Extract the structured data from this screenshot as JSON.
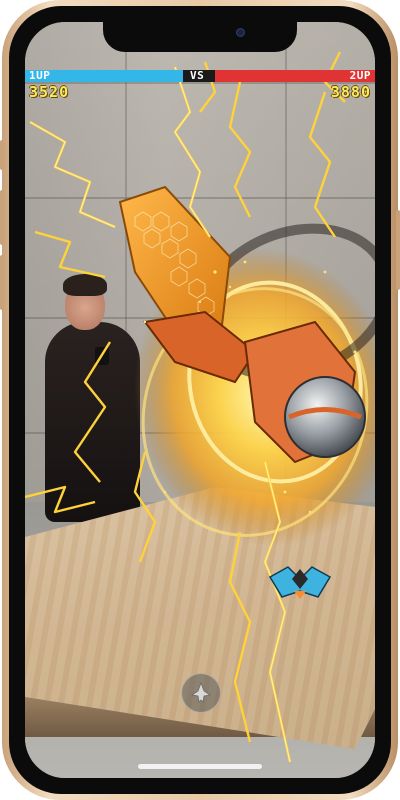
{
  "hud": {
    "player1_label": "1UP",
    "vs_label": "VS",
    "player2_label": "2UP",
    "player1_score": "3520",
    "player2_score": "3880"
  },
  "colors": {
    "player1_bar": "#33b7e8",
    "player2_bar": "#e03434",
    "score_text": "#f7e96a",
    "lightning": "#ffd23a"
  },
  "controls": {
    "fire_button_icon": "fighter-ship-icon"
  }
}
